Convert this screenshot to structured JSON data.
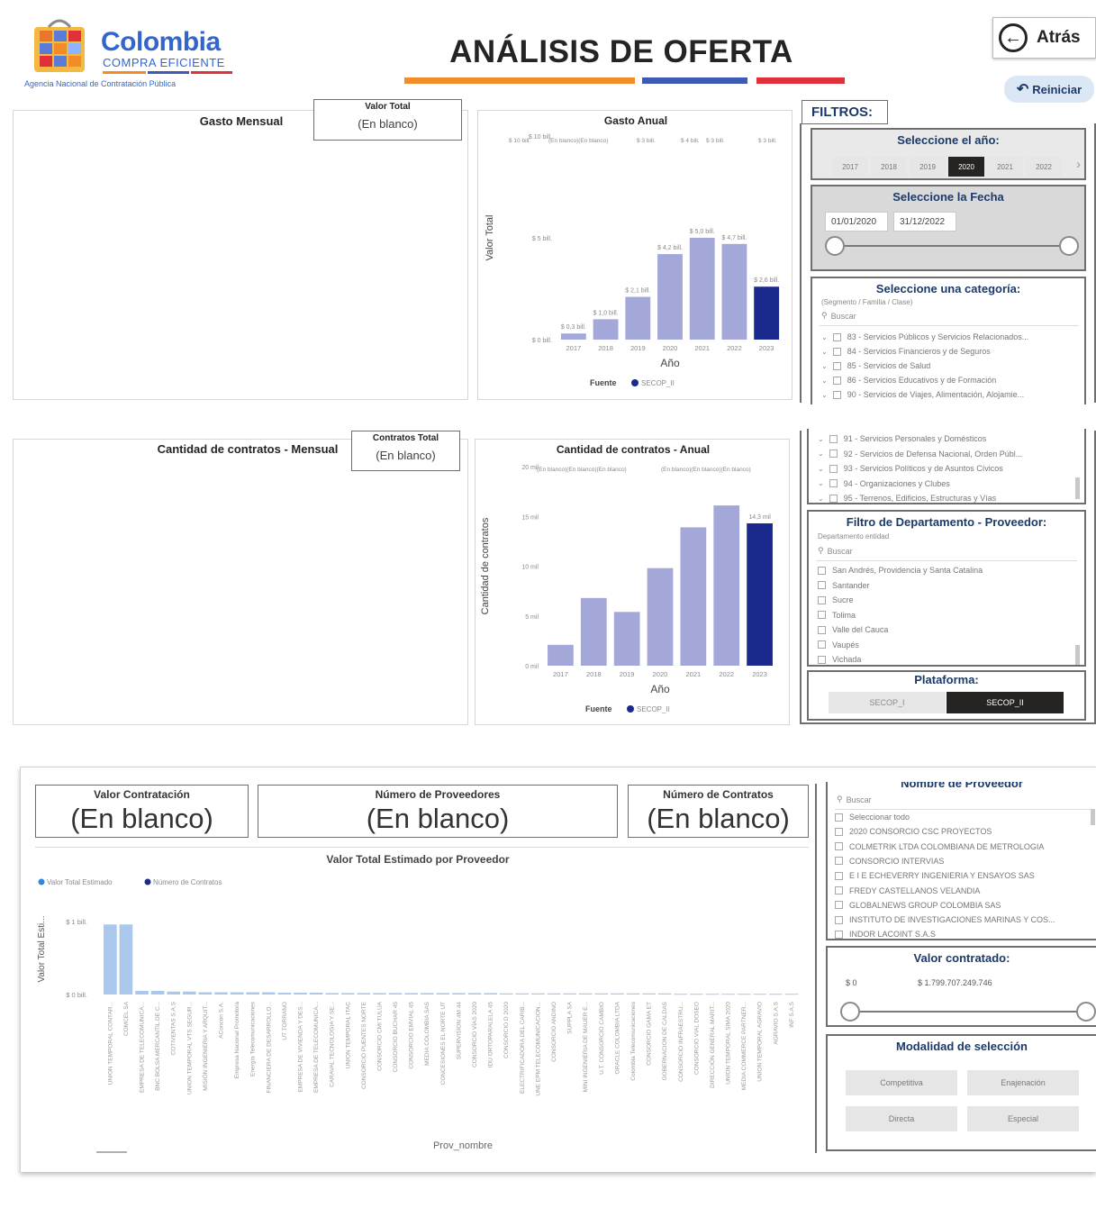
{
  "header": {
    "logo_line1": "Colombia",
    "logo_line2": "COMPRA EFICIENTE",
    "logo_line3": "Agencia Nacional de Contratación Pública",
    "title": "ANÁLISIS DE OFERTA",
    "back_label": "Atrás",
    "reset_label": "Reiniciar",
    "colors": {
      "orange": "#f28c28",
      "blue": "#3b5bb5",
      "red": "#e0303a",
      "brand": "#3366cc"
    }
  },
  "gasto_mensual": {
    "title": "Gasto Mensual",
    "card_label": "Valor Total",
    "card_value": "(En blanco)"
  },
  "contratos_mensual": {
    "title": "Cantidad de contratos - Mensual",
    "card_label": "Contratos Total",
    "card_value": "(En blanco)"
  },
  "chart_data": [
    {
      "type": "bar",
      "title": "Gasto Anual",
      "xlabel": "Año",
      "ylabel": "Valor Total",
      "categories": [
        "2017",
        "2018",
        "2019",
        "2020",
        "2021",
        "2022",
        "2023"
      ],
      "values": [
        0.3,
        1.0,
        2.1,
        4.2,
        5.0,
        4.7,
        2.6
      ],
      "data_labels": [
        "$ 0,3 bill.",
        "$ 1,0 bill.",
        "$ 2,1 bill.",
        "$ 4,2 bill.",
        "$ 5,0 bill.",
        "$ 4,7 bill.",
        "$ 2,6 bill."
      ],
      "yticks": [
        "$ 0 bill.",
        "$ 5 bill.",
        "$ 10 bill."
      ],
      "ylim": [
        0,
        10
      ],
      "top_row_labels": [
        "$ 10 bill.",
        "(En blanco)(En blanco)",
        "$ 3 bill.",
        "$ 4 bill.",
        "$ 3 bill.",
        "$ 3 bill."
      ],
      "highlight_index": 6,
      "legend_title": "Fuente",
      "legend_item": "SECOP_II"
    },
    {
      "type": "bar",
      "title": "Cantidad de contratos - Anual",
      "xlabel": "Año",
      "ylabel": "Cantidad de contratos",
      "categories": [
        "2017",
        "2018",
        "2019",
        "2020",
        "2021",
        "2022",
        "2023"
      ],
      "values": [
        2.1,
        6.8,
        5.4,
        9.8,
        13.9,
        16.1,
        14.3
      ],
      "data_labels": [
        "",
        "",
        "",
        "",
        "",
        "",
        "14,3 mil"
      ],
      "yticks": [
        "0 mil",
        "5 mil",
        "10 mil",
        "15 mil",
        "20 mil"
      ],
      "ylim": [
        0,
        20
      ],
      "top_row_labels": [
        "(En blanco)(En blanco)(En blanco)",
        "(En blanco)(En blanco)(En blanco)"
      ],
      "highlight_index": 6,
      "legend_title": "Fuente",
      "legend_item": "SECOP_II"
    },
    {
      "type": "bar",
      "title": "Valor Total Estimado por Proveedor",
      "xlabel": "Prov_nombre",
      "ylabel": "Valor Total Esti...",
      "legend": [
        "Valor Total Estimado",
        "Número de Contratos"
      ],
      "yticks": [
        "$ 0 bill.",
        "$ 1 bill."
      ],
      "ylim": [
        0,
        1
      ],
      "categories": [
        "UNION TEMPORAL CONTAR...",
        "COMCEL SA",
        "EMPRESA DE TELECOMUNICA...",
        "BNC BOLSA MERCANTIL DE C...",
        "COTIVENTAS S.A.S",
        "UNION TEMPORAL VTS SEGUR...",
        "MISIÓN INGENIERIA Y ARQUIT...",
        "AConcon S.A.",
        "Empresa Nacional Promotora",
        "Energía Telecomunicaciones",
        "FINANCIERA DE DESARROLLO...",
        "UT TORRANO",
        "EMPRESA DE VIVIENDA Y DES...",
        "EMPRESA DE TELECOMUNICA...",
        "CARAVAL TECNOLOGIA Y SE...",
        "UNION TEMPORAL ITAC",
        "CONSORCIO PUENTES NORTE",
        "CONSORCIO CMI TULUA",
        "CONSORCIO BUCHAR 45",
        "CONSORCIO EMVIAL 45",
        "MEDIA COLOMBIA SAS",
        "CONCESIONES EL NORTE UT",
        "SUPERVISION 4M 44",
        "CONSORCIO VÍAS 2020",
        "IDU ORTOPARALELA 45",
        "CONSORCIO D 2020",
        "ELECTRIFICADORA DEL CARIB...",
        "UNE EPM TELECOMUNICACION...",
        "CONSORCIO ANDINO",
        "SUPPLA SA",
        "MINI INGENIERIA DE MAUER E...",
        "U.T. CONSORCIO CAMBIO",
        "ORACLE COLOMBIA LTDA",
        "Colombia Telecomunicaciones",
        "CONSORCIO GAMA ET",
        "GOBERNACION DE CALDAS",
        "CONSORCIO INFRAESTRU...",
        "CONSORCIO VIAL DOSEO",
        "DIRECCIÓN GENERAL MARIT...",
        "UNION TEMPORAL SIMA 2020",
        "MEDIA COMMERCE PARTNER...",
        "UNION TEMPORAL AGRAVIO",
        "AGRAVIO S.A.S",
        "INF S.A.S"
      ],
      "values": [
        0.96,
        0.96,
        0.05,
        0.05,
        0.04,
        0.04,
        0.03,
        0.03,
        0.03,
        0.03,
        0.03,
        0.025,
        0.025,
        0.025,
        0.02,
        0.02,
        0.02,
        0.02,
        0.02,
        0.02,
        0.02,
        0.02,
        0.02,
        0.02,
        0.02,
        0.015,
        0.015,
        0.015,
        0.015,
        0.015,
        0.015,
        0.015,
        0.015,
        0.015,
        0.015,
        0.015,
        0.01,
        0.01,
        0.01,
        0.01,
        0.01,
        0.01,
        0.01,
        0.01
      ]
    }
  ],
  "filters": {
    "label": "FILTROS:",
    "year": {
      "title": "Seleccione el año:",
      "options": [
        "2017",
        "2018",
        "2019",
        "2020",
        "2021",
        "2022"
      ],
      "selected": "2020"
    },
    "date": {
      "title": "Seleccione la Fecha",
      "start": "01/01/2020",
      "end": "31/12/2022"
    },
    "category": {
      "title": "Seleccione una categoría:",
      "subtitle": "(Segmento / Familia / Clase)",
      "search_placeholder": "Buscar",
      "items": [
        "83 - Servicios Públicos y Servicios Relacionados...",
        "84 - Servicios Financieros y de Seguros",
        "85 - Servicios de Salud",
        "86 - Servicios Educativos y de Formación",
        "90 - Servicios de Viajes, Alimentación, Alojamie...",
        "91 - Servicios Personales y Domésticos",
        "92 - Servicios de Defensa Nacional, Orden Públ...",
        "93 - Servicios Políticos y de Asuntos Cívicos",
        "94 - Organizaciones y Clubes",
        "95 - Terrenos, Edificios, Estructuras y Vías"
      ]
    },
    "department": {
      "title": "Filtro de Departamento - Proveedor:",
      "subtitle": "Departamento entidad",
      "search_placeholder": "Buscar",
      "items": [
        "San Andrés, Providencia y Santa Catalina",
        "Santander",
        "Sucre",
        "Tolima",
        "Valle del Cauca",
        "Vaupés",
        "Vichada"
      ]
    },
    "platform": {
      "title": "Plataforma:",
      "options": [
        "SECOP_I",
        "SECOP_II"
      ],
      "selected": "SECOP_II"
    }
  },
  "kpis": {
    "valor_contratacion": {
      "label": "Valor Contratación",
      "value": "(En blanco)"
    },
    "numero_proveedores": {
      "label": "Número de Proveedores",
      "value": "(En blanco)"
    },
    "numero_contratos": {
      "label": "Número de Contratos",
      "value": "(En blanco)"
    }
  },
  "providers_filter": {
    "title": "Nombre de Proveedor",
    "search_placeholder": "Buscar",
    "items": [
      "Seleccionar todo",
      "2020 CONSORCIO CSC PROYECTOS",
      "COLMETRIK LTDA COLOMBIANA DE METROLOGIA",
      "CONSORCIO INTERVIAS",
      "E I E ECHEVERRY INGENIERIA Y ENSAYOS SAS",
      "FREDY CASTELLANOS VELANDIA",
      "GLOBALNEWS GROUP COLOMBIA SAS",
      "INSTITUTO DE INVESTIGACIONES MARINAS Y COS...",
      "INDOR LACOINT S.A.S"
    ]
  },
  "valor_contratado": {
    "title": "Valor contratado:",
    "min": "$ 0",
    "max": "$ 1.799.707.249.746"
  },
  "modalidad": {
    "title": "Modalidad de selección",
    "options": [
      "Competitiva",
      "Enajenación",
      "Directa",
      "Especial"
    ]
  }
}
